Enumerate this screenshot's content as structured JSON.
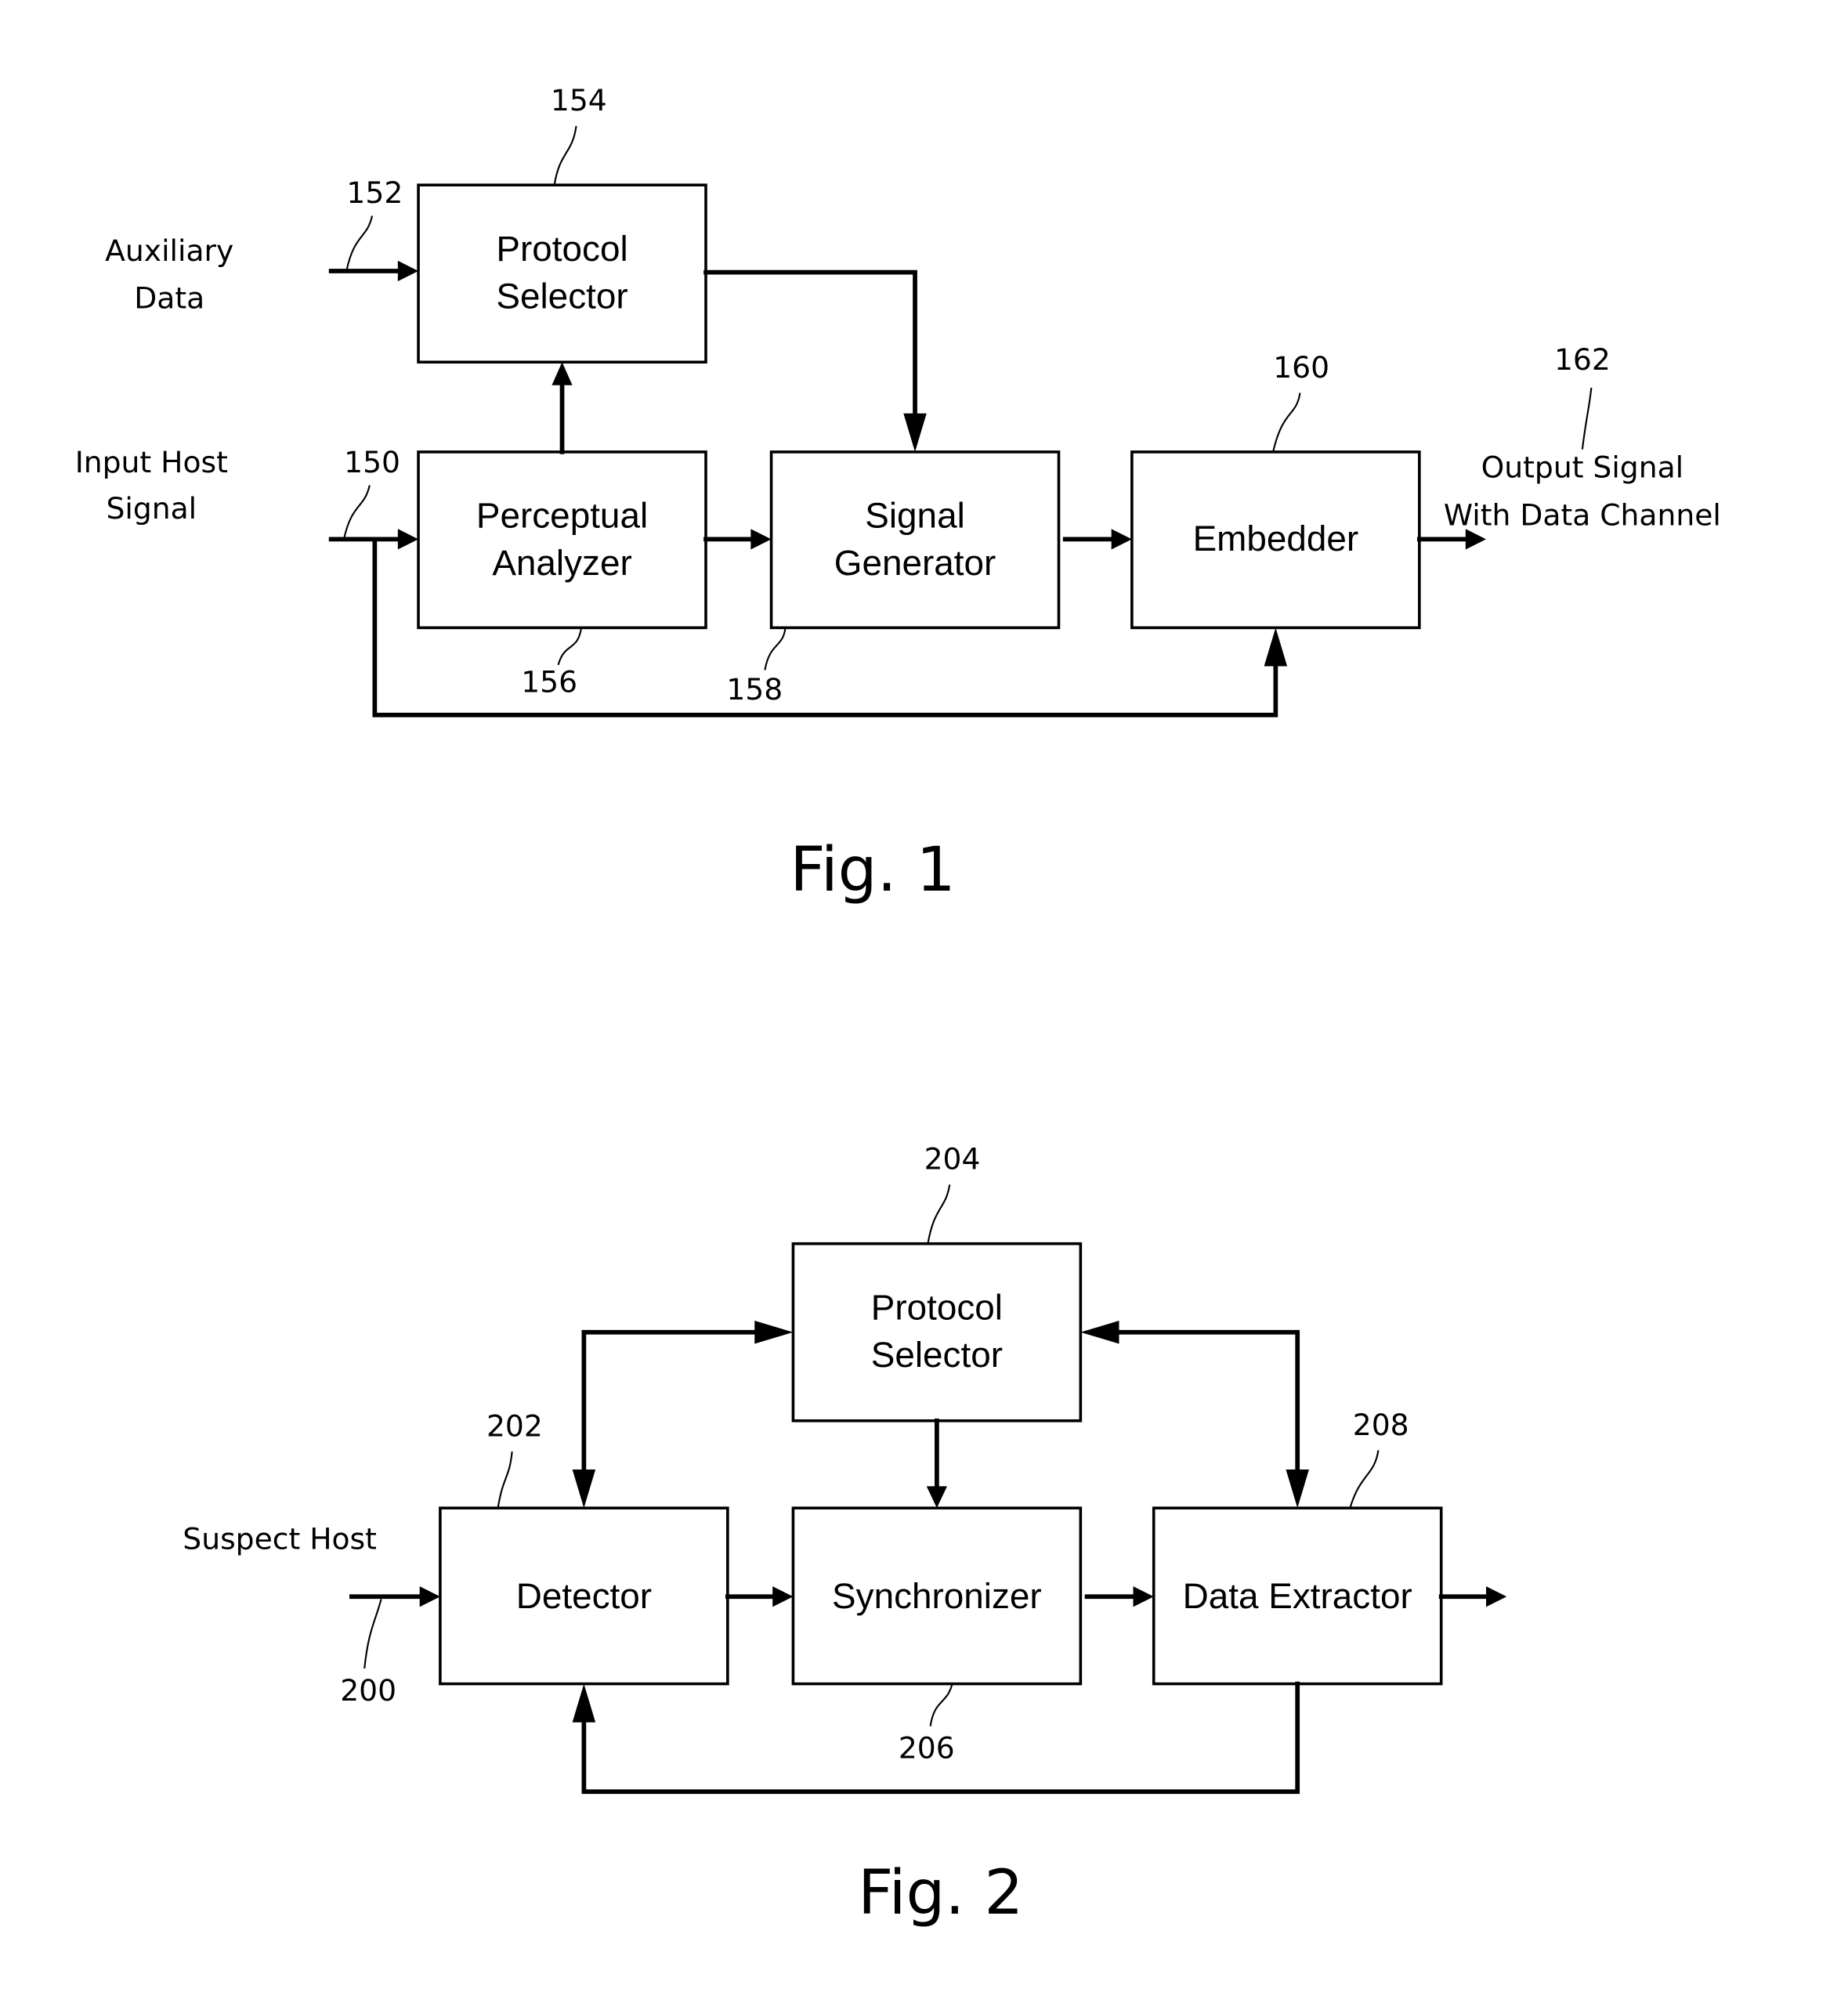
{
  "figures": [
    {
      "caption": "Fig. 1",
      "blocks": {
        "protocol_selector": {
          "line1": "Protocol",
          "line2": "Selector",
          "ref": "154"
        },
        "perceptual_analyzer": {
          "line1": "Perceptual",
          "line2": "Analyzer",
          "ref": "156"
        },
        "signal_generator": {
          "line1": "Signal",
          "line2": "Generator",
          "ref": "158"
        },
        "embedder": {
          "line1": "Embedder",
          "ref": "160"
        }
      },
      "inputs": {
        "auxiliary_data": {
          "line1": "Auxiliary",
          "line2": "Data",
          "ref": "152"
        },
        "input_host_signal": {
          "line1": "Input Host",
          "line2": "Signal",
          "ref": "150"
        }
      },
      "outputs": {
        "output_signal": {
          "line1": "Output Signal",
          "line2": "With Data Channel",
          "ref": "162"
        }
      }
    },
    {
      "caption": "Fig. 2",
      "blocks": {
        "protocol_selector": {
          "line1": "Protocol",
          "line2": "Selector",
          "ref": "204"
        },
        "detector": {
          "line1": "Detector",
          "ref": "202"
        },
        "synchronizer": {
          "line1": "Synchronizer",
          "ref": "206"
        },
        "data_extractor": {
          "line1": "Data Extractor",
          "ref": "208"
        }
      },
      "inputs": {
        "suspect_host": {
          "line1": "Suspect Host",
          "ref": "200"
        }
      }
    }
  ]
}
